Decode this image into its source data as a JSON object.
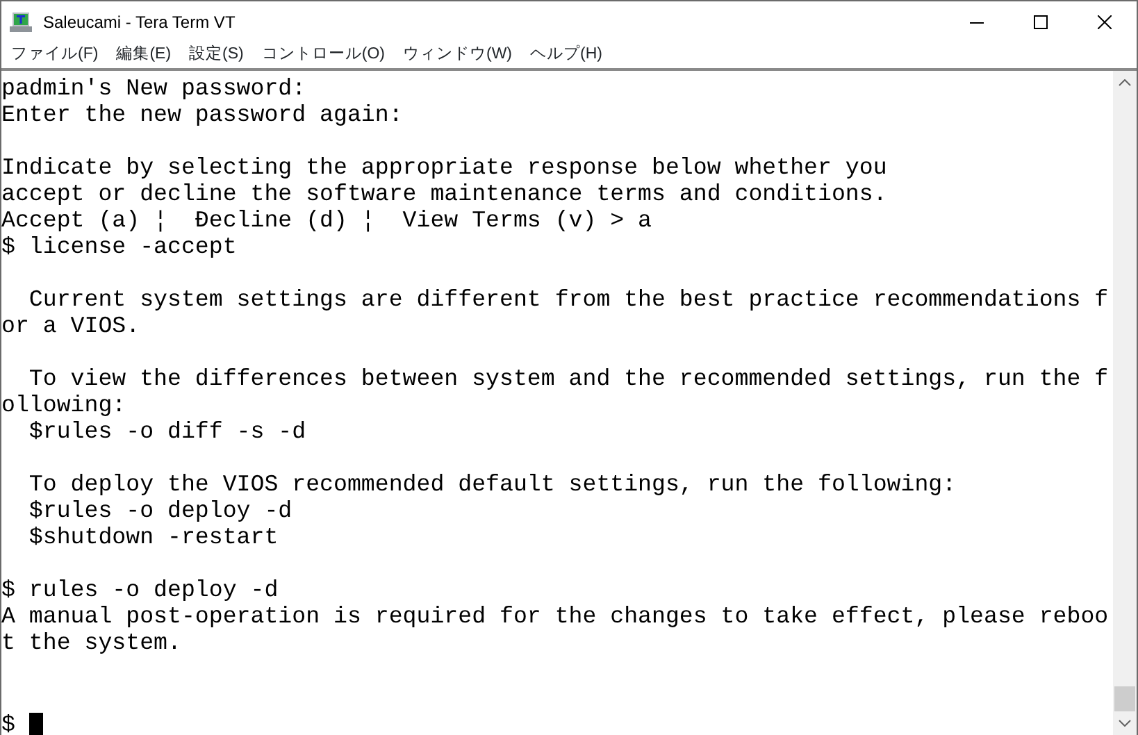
{
  "window": {
    "title": "Saleucami - Tera Term VT"
  },
  "menu": [
    "ファイル(F)",
    "編集(E)",
    "設定(S)",
    "コントロール(O)",
    "ウィンドウ(W)",
    "ヘルプ(H)"
  ],
  "terminal": {
    "blocks": [
      [
        "padmin's New password:",
        "Enter the new password again:"
      ],
      [
        "Indicate by selecting the appropriate response below whether you",
        "accept or decline the software maintenance terms and conditions.",
        "Accept (a) ¦  Đecline (d) ¦  View Terms (v) > a",
        "$ license -accept"
      ],
      [
        "  Current system settings are different from the best practice recommendations f",
        "or a VIOS."
      ],
      [
        "  To view the differences between system and the recommended settings, run the f",
        "ollowing:",
        "  $rules -o diff -s -d"
      ],
      [
        "  To deploy the VIOS recommended default settings, run the following:",
        "  $rules -o deploy -d",
        "  $shutdown -restart"
      ],
      [
        "$ rules -o deploy -d",
        "A manual post-operation is required for the changes to take effect, please reboo",
        "t the system."
      ]
    ],
    "prompt": "$"
  }
}
